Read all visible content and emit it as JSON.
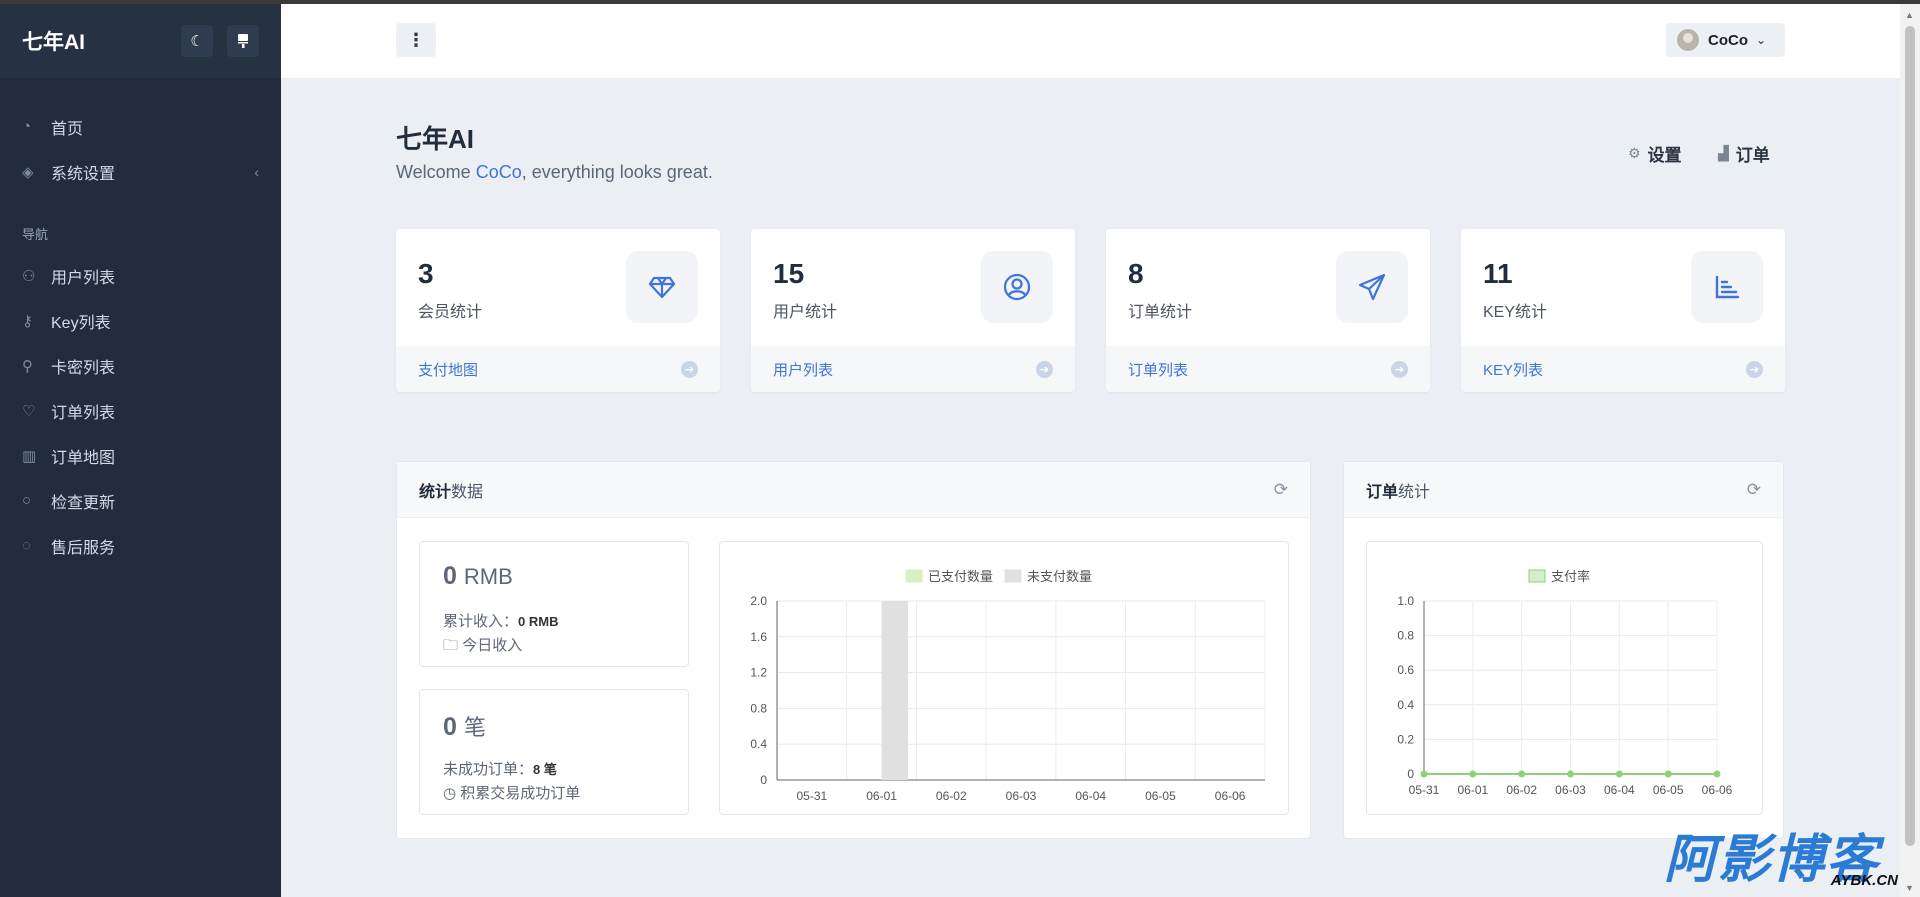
{
  "app": {
    "brand": "七年AI"
  },
  "sidebar": {
    "items_top": [
      {
        "icon": "dashboard-icon",
        "label": "首页"
      },
      {
        "icon": "layers-icon",
        "label": "系统设置",
        "caret": "‹"
      }
    ],
    "section_label": "导航",
    "items_nav": [
      {
        "icon": "users-icon",
        "label": "用户列表"
      },
      {
        "icon": "key-icon",
        "label": "Key列表"
      },
      {
        "icon": "card-icon",
        "label": "卡密列表"
      },
      {
        "icon": "heart-icon",
        "label": "订单列表"
      },
      {
        "icon": "map-icon",
        "label": "订单地图"
      },
      {
        "icon": "refresh-icon",
        "label": "检查更新"
      },
      {
        "icon": "chat-icon",
        "label": "售后服务"
      }
    ]
  },
  "header": {
    "menu_glyph": "⋮",
    "username": "CoCo"
  },
  "page": {
    "title": "七年AI",
    "welcome_prefix": "Welcome ",
    "welcome_name": "CoCo",
    "welcome_suffix": ", everything looks great.",
    "quick_settings": "设置",
    "quick_orders": "订单"
  },
  "stats": [
    {
      "value": "3",
      "label": "会员统计",
      "link": "支付地图",
      "icon": "diamond-icon"
    },
    {
      "value": "15",
      "label": "用户统计",
      "link": "用户列表",
      "icon": "user-circle-icon"
    },
    {
      "value": "8",
      "label": "订单统计",
      "link": "订单列表",
      "icon": "paper-plane-icon"
    },
    {
      "value": "11",
      "label": "KEY统计",
      "link": "KEY列表",
      "icon": "bar-chart-icon"
    }
  ],
  "panel_stats": {
    "title_bold": "统计",
    "title_rest": "数据",
    "income": {
      "value": "0",
      "unit": "RMB",
      "line1_label": "累计收入：",
      "line1_value": "0 RMB",
      "line2": "今日收入"
    },
    "orders": {
      "value": "0",
      "unit": "笔",
      "line1_label": "未成功订单：",
      "line1_value": "8 笔",
      "line2": "积累交易成功订单"
    }
  },
  "panel_orders": {
    "title_bold": "订单",
    "title_rest": "统计"
  },
  "watermark": {
    "main": "阿影博客",
    "sub": "AYBK.CN"
  },
  "colors": {
    "sidebar": "#222c3c",
    "accent": "#3f74d8",
    "paid": "#d6f0c2",
    "unpaid": "#e0e0e0",
    "rate": "#8fd17a"
  },
  "chart_data": [
    {
      "type": "bar",
      "categories": [
        "05-31",
        "06-01",
        "06-02",
        "06-03",
        "06-04",
        "06-05",
        "06-06"
      ],
      "series": [
        {
          "name": "已支付数量",
          "values": [
            0,
            0,
            0,
            0,
            0,
            0,
            0
          ]
        },
        {
          "name": "未支付数量",
          "values": [
            0,
            2,
            0,
            0,
            0,
            0,
            0
          ]
        }
      ],
      "ylim": [
        0,
        2.0
      ],
      "yticks": [
        "2.0",
        "1.6",
        "1.2",
        "0.8",
        "0.4",
        "0"
      ],
      "legend": "top",
      "grid": true
    },
    {
      "type": "line",
      "categories": [
        "05-31",
        "06-01",
        "06-02",
        "06-03",
        "06-04",
        "06-05",
        "06-06"
      ],
      "series": [
        {
          "name": "支付率",
          "values": [
            0,
            0,
            0,
            0,
            0,
            0,
            0
          ]
        }
      ],
      "ylim": [
        0,
        1.0
      ],
      "yticks": [
        "1.0",
        "0.8",
        "0.6",
        "0.4",
        "0.2",
        "0"
      ],
      "legend": "top",
      "grid": true
    }
  ]
}
